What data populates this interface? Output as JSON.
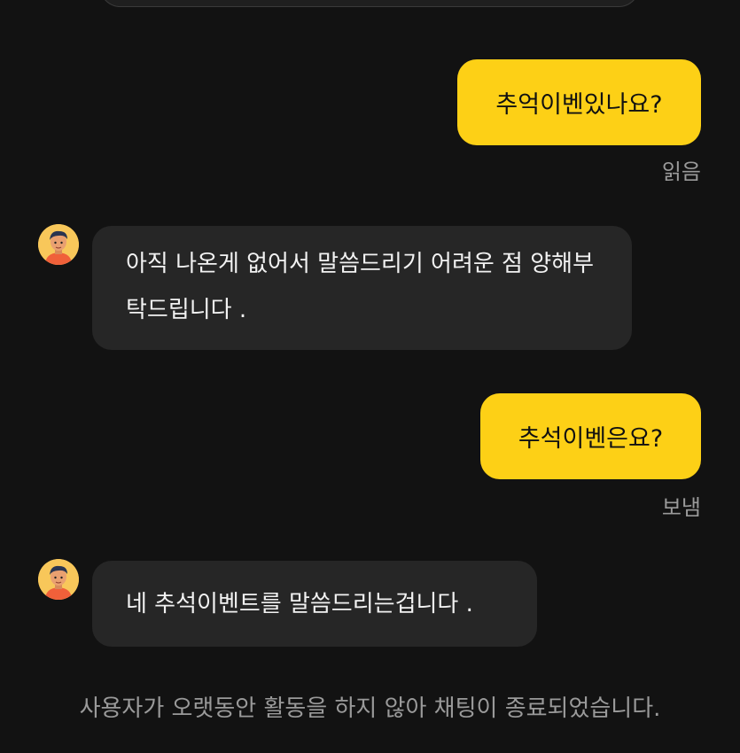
{
  "messages": [
    {
      "from": "user",
      "text": "추억이벤있나요?",
      "status": "읽음"
    },
    {
      "from": "agent",
      "text": "아직 나온게 없어서 말씀드리기 어려운 점 양해부탁드립니다 .",
      "avatar": "agent-avatar"
    },
    {
      "from": "user",
      "text": "추석이벤은요?",
      "status": "보냄"
    },
    {
      "from": "agent",
      "text": "네 추석이벤트를 말씀드리는겁니다 .",
      "avatar": "agent-avatar"
    }
  ],
  "system_notice": "사용자가 오랫동안 활동을 하지 않아 채팅이 종료되었습니다.",
  "colors": {
    "background": "#121212",
    "outgoing_bubble": "#fdd016",
    "incoming_bubble": "#262626",
    "muted_text": "#9a9a9a"
  }
}
